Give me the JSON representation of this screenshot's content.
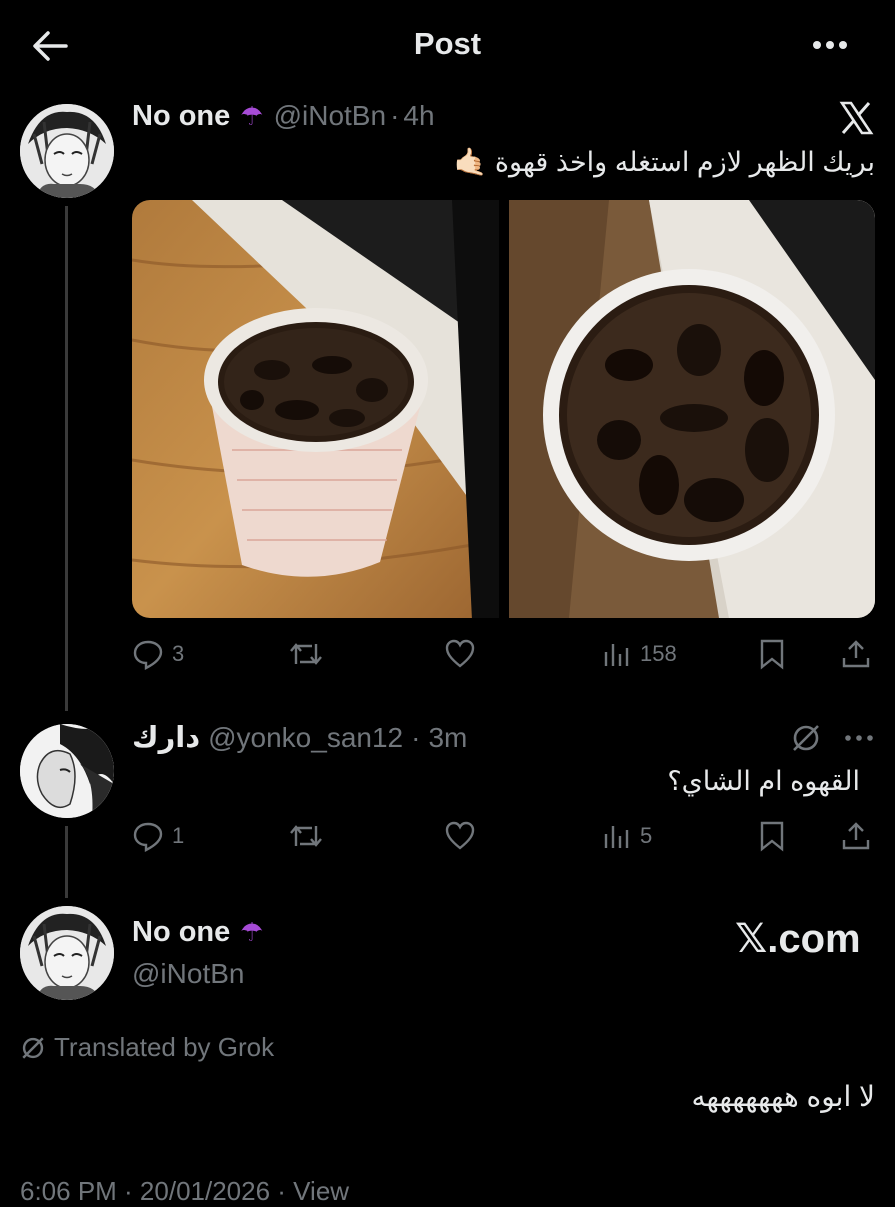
{
  "header": {
    "title": "Post"
  },
  "post": {
    "author_name": "No one",
    "author_emoji": "☂",
    "handle": "@iNotBn",
    "sep": "·",
    "time": "4h",
    "text": "بريك الظهر لازم استغله واخذ قهوة 🤙🏻",
    "stats": {
      "replies": "3",
      "views": "158"
    }
  },
  "reply": {
    "author_name": "دارك",
    "handle": "@yonko_san12",
    "sep": "·",
    "time": "3m",
    "text": "القهوه ام الشاي؟",
    "stats": {
      "replies": "1",
      "views": "5"
    }
  },
  "main": {
    "author_name": "No one",
    "author_emoji": "☂",
    "handle": "@iNotBn",
    "watermark": "𝕏.com",
    "translated_label": "Translated by Grok",
    "text": "لا ابوه هههههههه",
    "footer": "6:06 PM · 20/01/2026 · View"
  },
  "icons": [
    "back-arrow-icon",
    "more-icon",
    "x-logo-icon",
    "reply-icon",
    "repost-icon",
    "like-icon",
    "views-icon",
    "bookmark-icon",
    "share-icon",
    "grok-icon"
  ],
  "colors": {
    "bg": "#000000",
    "text": "#e7e9ea",
    "muted": "#71767b",
    "thread": "#3a3a3a"
  }
}
